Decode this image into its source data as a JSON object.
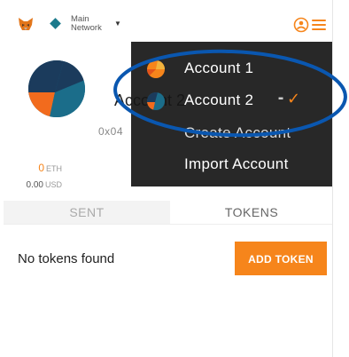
{
  "network": {
    "label_line1": "Main",
    "label_line2": "Network",
    "caret": "▼"
  },
  "icons": {
    "fox": "metamask-fox-icon",
    "network_dot": "network-diamond-icon",
    "accounts": "account-switcher-icon",
    "menu": "hamburger-menu-icon",
    "check": "checkmark-icon"
  },
  "account": {
    "name": "Account 2",
    "address": "0x04",
    "eth_value": "0",
    "eth_unit": "ETH",
    "usd_value": "0.00",
    "usd_unit": "USD"
  },
  "tabs": [
    {
      "label": "SENT"
    },
    {
      "label": "TOKENS"
    }
  ],
  "tokens": {
    "empty_text": "No tokens found",
    "add_label": "ADD TOKEN"
  },
  "menu": {
    "items": [
      {
        "label": "Account 1"
      },
      {
        "label": "Account 2",
        "check": "✓",
        "dots": "▪▪"
      },
      {
        "label": "Create Account"
      },
      {
        "label": "Import Account"
      }
    ]
  },
  "colors": {
    "accent": "#f6851b",
    "menu_bg": "#161616",
    "annotation": "#0a57b0",
    "avatar_orange": "#f26b1d",
    "avatar_teal": "#1b6d8a",
    "avatar_navy": "#1b3b5c"
  }
}
